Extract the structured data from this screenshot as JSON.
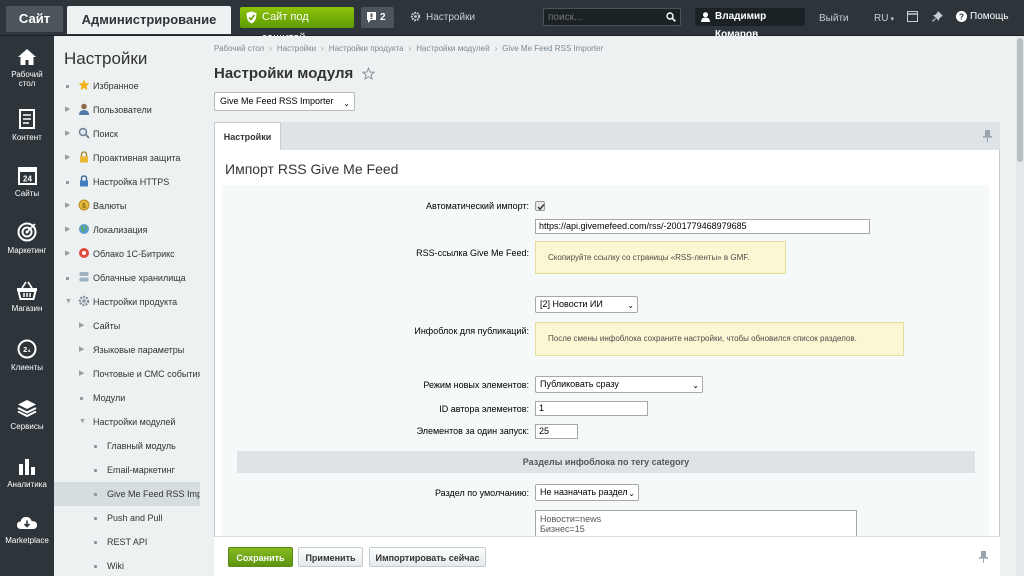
{
  "topbar": {
    "site_tab": "Сайт",
    "admin_tab": "Администрирование",
    "protected_label": "Сайт под защитой",
    "notifications_count": "2",
    "settings_label": "Настройки",
    "search_placeholder": "поиск...",
    "user_name": "Владимир Комаров",
    "logout_label": "Выйти",
    "language": "RU",
    "help_label": "Помощь"
  },
  "leftnav": [
    {
      "label": "Рабочий стол",
      "icon": "house-icon"
    },
    {
      "label": "Контент",
      "icon": "document-icon"
    },
    {
      "label": "Сайты",
      "icon": "calendar-icon"
    },
    {
      "label": "Маркетинг",
      "icon": "target-icon"
    },
    {
      "label": "Магазин",
      "icon": "basket-icon"
    },
    {
      "label": "Клиенты",
      "icon": "clients-icon"
    },
    {
      "label": "Сервисы",
      "icon": "layers-icon"
    },
    {
      "label": "Аналитика",
      "icon": "bar-chart-icon"
    },
    {
      "label": "Marketplace",
      "icon": "cloud-download-icon"
    }
  ],
  "sidebar": {
    "title": "Настройки",
    "items": [
      {
        "label": "Избранное",
        "icon": "star-icon"
      },
      {
        "label": "Пользователи",
        "icon": "user-icon"
      },
      {
        "label": "Поиск",
        "icon": "search-icon"
      },
      {
        "label": "Проактивная защита",
        "icon": "lock-icon"
      },
      {
        "label": "Настройка HTTPS",
        "icon": "https-lock-icon"
      },
      {
        "label": "Валюты",
        "icon": "coin-icon"
      },
      {
        "label": "Локализация",
        "icon": "globe-icon"
      },
      {
        "label": "Облако 1С-Битрикс",
        "icon": "bitrix-cloud-icon"
      },
      {
        "label": "Облачные хранилища",
        "icon": "storage-icon"
      },
      {
        "label": "Настройки продукта",
        "icon": "gear-icon"
      },
      {
        "label": "Сайты"
      },
      {
        "label": "Языковые параметры"
      },
      {
        "label": "Почтовые и СМС события"
      },
      {
        "label": "Модули"
      },
      {
        "label": "Настройки модулей"
      },
      {
        "label": "Главный модуль"
      },
      {
        "label": "Email-маркетинг"
      },
      {
        "label": "Give Me Feed RSS Importer"
      },
      {
        "label": "Push and Pull"
      },
      {
        "label": "REST API"
      },
      {
        "label": "Wiki"
      }
    ]
  },
  "breadcrumb": [
    "Рабочий стол",
    "Настройки",
    "Настройки продукта",
    "Настройки модулей",
    "Give Me Feed RSS Importer"
  ],
  "page": {
    "title": "Настройки модуля",
    "module_select": "Give Me Feed RSS Importer",
    "tab": "Настройки",
    "section_title": "Импорт RSS Give Me Feed"
  },
  "form": {
    "auto_import_label": "Автоматический импорт:",
    "auto_import_checked": true,
    "rss_url_value": "https://api.givemefeed.com/rss/-2001779468979685",
    "rss_label": "RSS-ссылка Give Me Feed:",
    "rss_hint": "Скопируйте ссылку со страницы «RSS-ленты» в GMF.",
    "iblock_select": "[2] Новости ИИ",
    "iblock_label": "Инфоблок для публикаций:",
    "iblock_hint": "После смены инфоблока сохраните настройки, чтобы обновился список разделов.",
    "mode_label": "Режим новых элементов:",
    "mode_value": "Публиковать сразу",
    "author_label": "ID автора элементов:",
    "author_value": "1",
    "batch_label": "Элементов за один запуск:",
    "batch_value": "25",
    "section_bar": "Разделы инфоблока по тегу category",
    "default_section_label": "Раздел по умолчанию:",
    "default_section_value": "Не назначать разделы",
    "mapping_text": "Новости=news\nБизнес=15"
  },
  "footer": {
    "save": "Сохранить",
    "apply": "Применить",
    "import_now": "Импортировать сейчас"
  },
  "colors": {
    "topbar": "#2d353a",
    "green_accent": "#6aa90a",
    "hint_bg": "#fcf7d3"
  }
}
